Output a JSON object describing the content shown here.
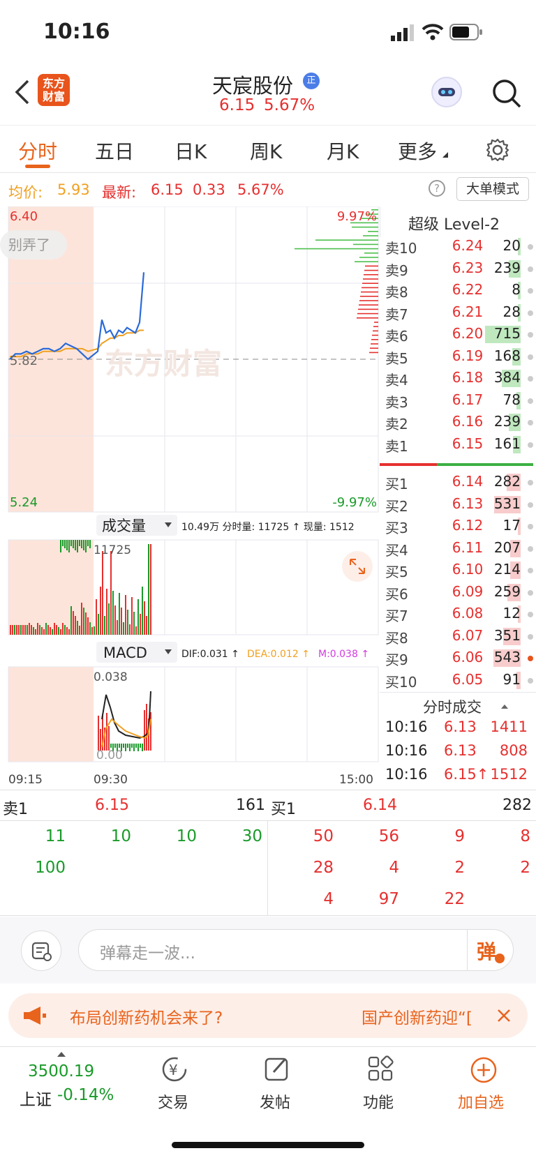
{
  "status_bar": {
    "time": "10:16"
  },
  "header": {
    "logo_text": "东方\n财富",
    "stock_name": "天宸股份",
    "badge": "正",
    "price": "6.15",
    "pct": "5.67%"
  },
  "tabs": [
    "分时",
    "五日",
    "日K",
    "周K",
    "月K",
    "更多"
  ],
  "info": {
    "avg_label": "均价:",
    "avg": "5.93",
    "latest_label": "最新:",
    "latest": "6.15",
    "change": "0.33",
    "pct": "5.67%",
    "mode_button": "大单模式"
  },
  "chart": {
    "max_price": "6.40",
    "min_price": "5.24",
    "base_price": "5.82",
    "max_pct": "9.97%",
    "min_pct": "-9.97%",
    "danmu_tag": "别弄了",
    "watermark": "东方财富"
  },
  "volume": {
    "selector": "成交量",
    "summary": "10.49万 分时量: 11725 ↑ 现量: 1512",
    "peak": "11725"
  },
  "macd": {
    "selector": "MACD",
    "dif": "DIF:0.031 ↑",
    "dea": "DEA:0.012 ↑",
    "m": "M:0.038 ↑",
    "top": "0.038",
    "bottom": "0.00"
  },
  "time_axis": {
    "t1": "09:15",
    "t2": "09:30",
    "t3": "15:00"
  },
  "chart_data": {
    "type": "line",
    "x_range": [
      "09:15",
      "15:00"
    ],
    "ylim": [
      5.24,
      6.4
    ],
    "base": 5.82,
    "series": [
      {
        "name": "price",
        "values": [
          5.82,
          5.84,
          5.84,
          5.85,
          5.84,
          5.85,
          5.86,
          5.86,
          5.85,
          5.86,
          5.88,
          5.87,
          5.86,
          5.84,
          5.82,
          5.85,
          5.97,
          5.92,
          5.93,
          5.9,
          5.93,
          5.92,
          5.94,
          5.93,
          5.92,
          5.96,
          6.15
        ]
      },
      {
        "name": "avg",
        "values": [
          5.83,
          5.83,
          5.83,
          5.84,
          5.84,
          5.84,
          5.85,
          5.85,
          5.85,
          5.85,
          5.86,
          5.86,
          5.86,
          5.86,
          5.85,
          5.86,
          5.88,
          5.89,
          5.9,
          5.9,
          5.91,
          5.91,
          5.92,
          5.92,
          5.92,
          5.93,
          5.93
        ]
      }
    ]
  },
  "level2": {
    "title": "超级 Level-2",
    "asks": [
      {
        "label": "卖10",
        "price": "6.24",
        "vol": "20"
      },
      {
        "label": "卖9",
        "price": "6.23",
        "vol": "239"
      },
      {
        "label": "卖8",
        "price": "6.22",
        "vol": "8"
      },
      {
        "label": "卖7",
        "price": "6.21",
        "vol": "28"
      },
      {
        "label": "卖6",
        "price": "6.20",
        "vol": "715"
      },
      {
        "label": "卖5",
        "price": "6.19",
        "vol": "168"
      },
      {
        "label": "卖4",
        "price": "6.18",
        "vol": "384"
      },
      {
        "label": "卖3",
        "price": "6.17",
        "vol": "78"
      },
      {
        "label": "卖2",
        "price": "6.16",
        "vol": "239"
      },
      {
        "label": "卖1",
        "price": "6.15",
        "vol": "161"
      }
    ],
    "bids": [
      {
        "label": "买1",
        "price": "6.14",
        "vol": "282"
      },
      {
        "label": "买2",
        "price": "6.13",
        "vol": "531"
      },
      {
        "label": "买3",
        "price": "6.12",
        "vol": "17"
      },
      {
        "label": "买4",
        "price": "6.11",
        "vol": "207"
      },
      {
        "label": "买5",
        "price": "6.10",
        "vol": "214"
      },
      {
        "label": "买6",
        "price": "6.09",
        "vol": "259"
      },
      {
        "label": "买7",
        "price": "6.08",
        "vol": "12"
      },
      {
        "label": "买8",
        "price": "6.07",
        "vol": "351"
      },
      {
        "label": "买9",
        "price": "6.06",
        "vol": "543"
      },
      {
        "label": "买10",
        "price": "6.05",
        "vol": "91"
      }
    ],
    "ticks_title": "分时成交",
    "ticks": [
      {
        "time": "10:16",
        "price": "6.13",
        "vol": "1411"
      },
      {
        "time": "10:16",
        "price": "6.13",
        "vol": "808"
      },
      {
        "time": "10:16",
        "price": "6.15↑",
        "vol": "1512"
      }
    ]
  },
  "queue": {
    "ask_label": "卖1",
    "ask_price": "6.15",
    "ask_vol": "161",
    "bid_label": "买1",
    "bid_price": "6.14",
    "bid_vol": "282",
    "ask_orders": [
      "11",
      "10",
      "10",
      "30",
      "100"
    ],
    "bid_orders": [
      "50",
      "56",
      "9",
      "8",
      "28",
      "4",
      "2",
      "2",
      "4",
      "97",
      "22"
    ]
  },
  "comment": {
    "placeholder": "弹幕走一波...",
    "send": "弹"
  },
  "banner": {
    "left": "布局创新药机会来了?",
    "right": "国产创新药迎“["
  },
  "bottom_nav": {
    "index_value": "3500.19",
    "index_name": "上证",
    "index_pct": "-0.14%",
    "items": [
      "交易",
      "发帖",
      "功能",
      "加自选"
    ]
  }
}
